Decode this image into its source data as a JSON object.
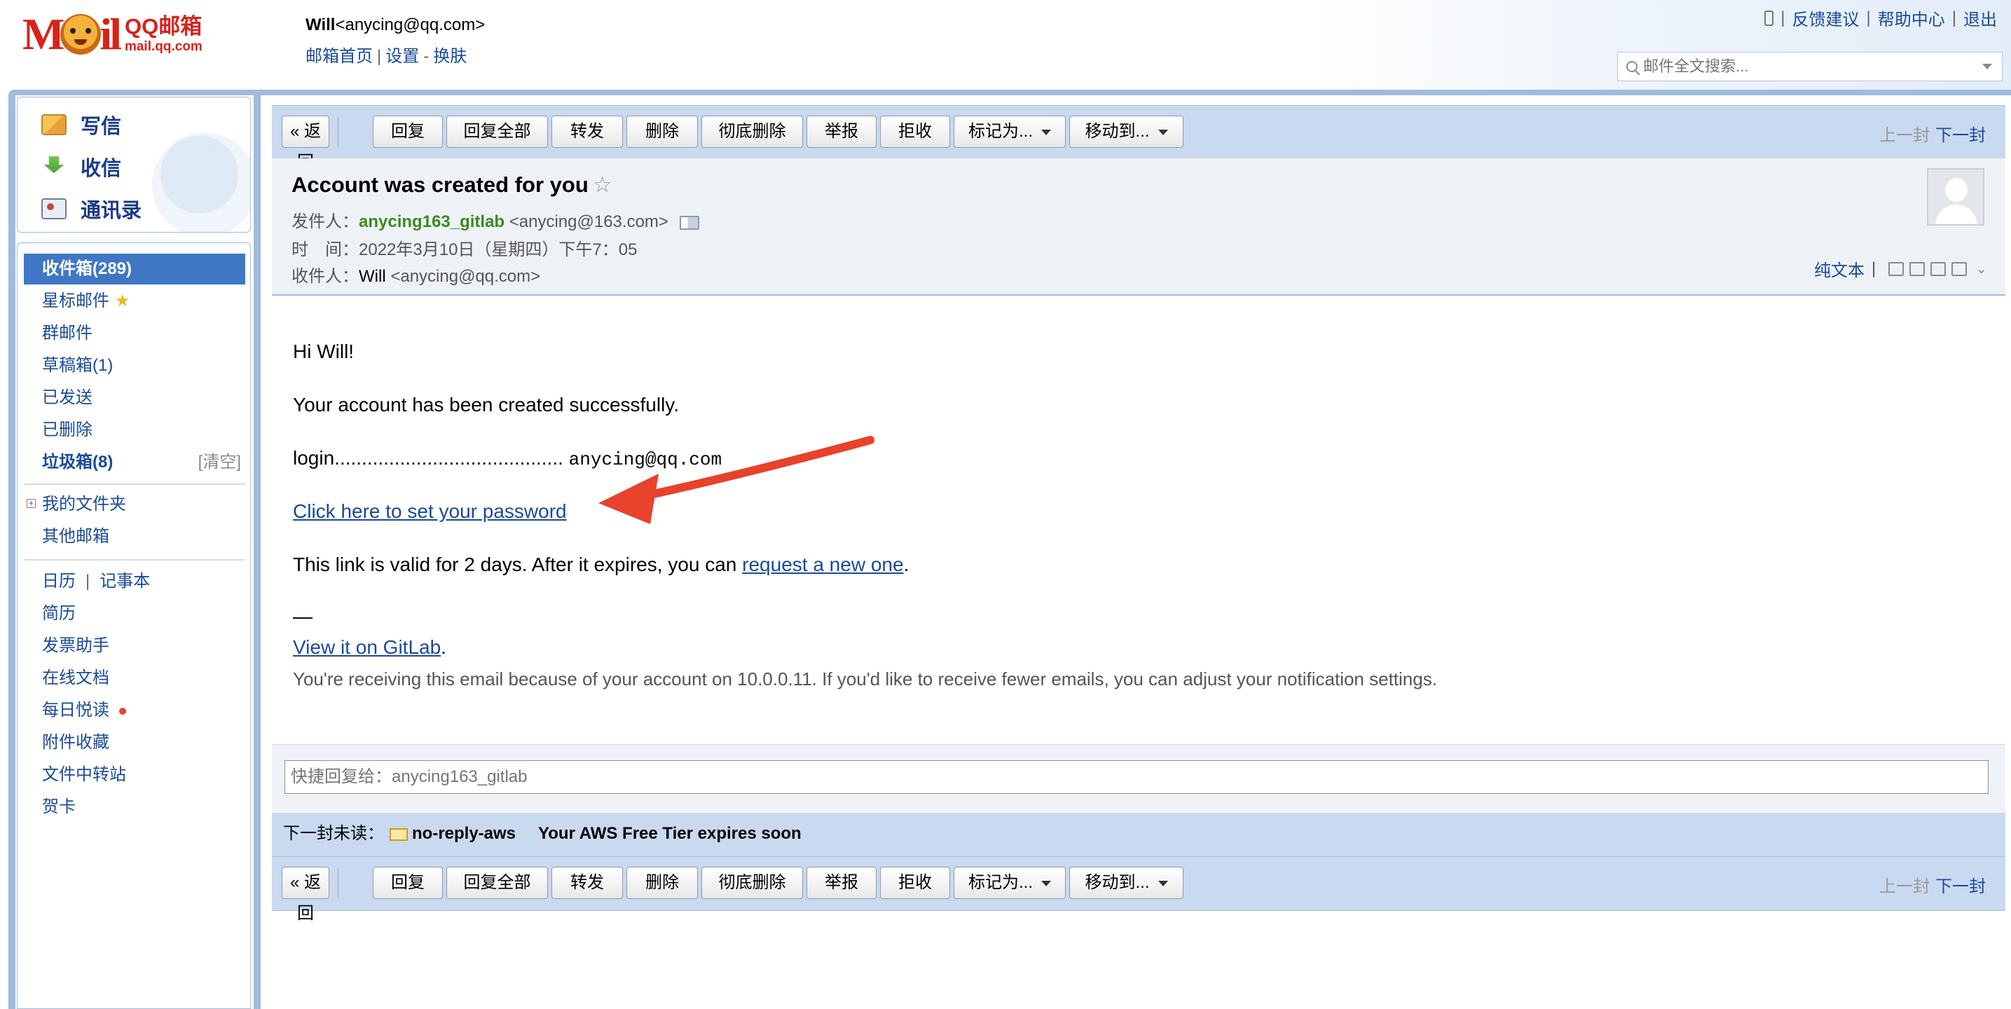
{
  "header": {
    "logo_text": "QQ邮箱",
    "logo_sub": "mail.qq.com",
    "user_name": "Will",
    "user_email": "<anycing@qq.com>",
    "links": [
      "邮箱首页",
      "设置",
      "换肤"
    ],
    "top_links": [
      "反馈建议",
      "帮助中心",
      "退出"
    ],
    "search_placeholder": "邮件全文搜索..."
  },
  "sidebar": {
    "compose": [
      "写信",
      "收信",
      "通讯录"
    ],
    "folders": {
      "inbox": "收件箱(289)",
      "starred": "星标邮件",
      "group": "群邮件",
      "drafts": "草稿箱(1)",
      "sent": "已发送",
      "deleted": "已删除",
      "spam": "垃圾箱(8)",
      "spam_clear": "[清空]",
      "my_folders": "我的文件夹",
      "other_mailbox": "其他邮箱",
      "calendar": "日历",
      "notepad": "记事本",
      "resume": "简历",
      "invoice": "发票助手",
      "docs": "在线文档",
      "daily_read": "每日悦读",
      "attachments": "附件收藏",
      "transfer": "文件中转站",
      "cards": "贺卡"
    }
  },
  "toolbar": {
    "back": "« 返回",
    "reply": "回复",
    "reply_all": "回复全部",
    "forward": "转发",
    "delete": "删除",
    "delete_perm": "彻底删除",
    "report": "举报",
    "reject": "拒收",
    "mark_as": "标记为...",
    "move_to": "移动到...",
    "prev": "上一封",
    "next": "下一封"
  },
  "mail": {
    "subject": "Account was created for you",
    "from_label": "发件人：",
    "from_name": "anycing163_gitlab",
    "from_email": "<anycing@163.com>",
    "time_label": "时　间：",
    "time_value": "2022年3月10日（星期四）下午7：05",
    "to_label": "收件人：",
    "to_name": "Will",
    "to_email": "<anycing@qq.com>",
    "plain_text": "纯文本",
    "body": {
      "greeting": "Hi Will!",
      "line1": "Your account has been created successfully.",
      "login_label": "login..........................................",
      "login_value": "anycing@qq.com",
      "set_password_link": "Click here to set your password",
      "validity_prefix": "This link is valid for 2 days. After it expires, you can ",
      "request_link": "request a new one",
      "dash": "—",
      "view_link": "View it on GitLab",
      "footer": "You're receiving this email because of your account on 10.0.0.11. If you'd like to receive fewer emails, you can adjust your notification settings."
    }
  },
  "quick_reply": {
    "placeholder": "快捷回复给：anycing163_gitlab"
  },
  "next_unread": {
    "label": "下一封未读：",
    "sender": "no-reply-aws",
    "subject": "Your AWS Free Tier expires soon"
  },
  "colors": {
    "accent": "#3f77c4",
    "annotation_arrow": "#e8412c",
    "sender_green": "#3d8a1e"
  }
}
